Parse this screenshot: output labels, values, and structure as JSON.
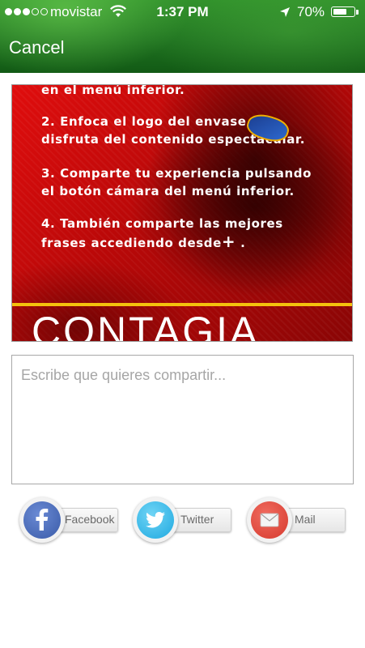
{
  "status_bar": {
    "carrier": "movistar",
    "time": "1:37 PM",
    "battery_percent": "70%",
    "battery_level": 0.7,
    "signal_bars_filled": 3,
    "signal_bars_total": 5
  },
  "nav": {
    "cancel_label": "Cancel"
  },
  "preview": {
    "lines": [
      "en el menú inferior.",
      "2. Enfoca el logo del envase  y",
      "disfruta del contenido espectacular.",
      "3. Comparte tu experiencia pulsando",
      "el botón cámara del menú inferior.",
      "4. También comparte las mejores",
      "frases accediendo desde"
    ],
    "plus_symbol": "+",
    "line_end": ".",
    "banner_text": "CONTAGIA"
  },
  "share_input": {
    "placeholder": "Escribe que quieres compartir...",
    "value": ""
  },
  "share_buttons": {
    "facebook_label": "Facebook",
    "twitter_label": "Twitter",
    "mail_label": "Mail"
  },
  "colors": {
    "header_green": "#1f7220",
    "poster_red": "#d00c0c",
    "banner_yellow": "#f4c20d",
    "facebook_blue": "#3a5ba8",
    "twitter_blue": "#1fa9e0",
    "mail_red": "#d63a2e"
  },
  "icons": {
    "signal": "signal-dots-icon",
    "wifi": "wifi-icon",
    "location": "location-arrow-icon",
    "battery": "battery-icon",
    "facebook": "facebook-icon",
    "twitter": "twitter-bird-icon",
    "mail": "mail-envelope-icon"
  }
}
